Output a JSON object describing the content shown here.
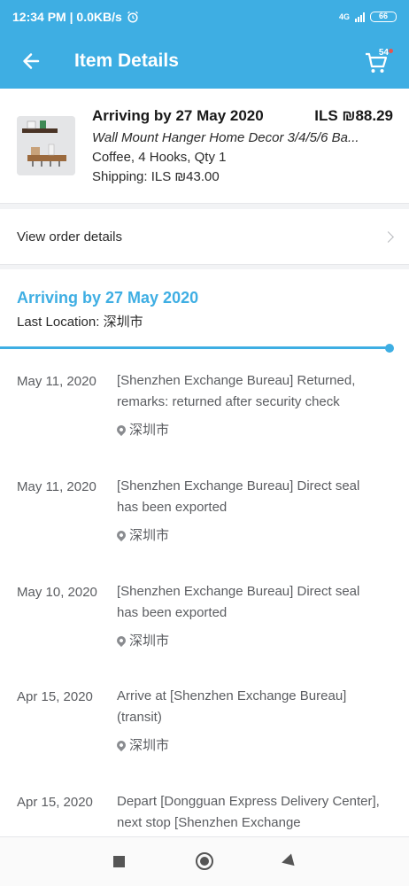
{
  "status_bar": {
    "time": "12:34 PM",
    "speed": "0.0KB/s",
    "network": "4G",
    "battery": "66"
  },
  "header": {
    "title": "Item Details",
    "cart_count": "54"
  },
  "item": {
    "arrival": "Arriving by 27 May 2020",
    "price": "ILS ₪88.29",
    "name": "Wall Mount Hanger Home Decor 3/4/5/6 Ba...",
    "variant": "Coffee, 4 Hooks, Qty 1",
    "shipping": "Shipping: ILS ₪43.00"
  },
  "order_link": {
    "label": "View order details"
  },
  "tracking": {
    "title": "Arriving by 27 May 2020",
    "last_location": "Last Location: 深圳市",
    "progress_fraction": 1.0,
    "events": [
      {
        "date": "May 11, 2020",
        "desc": "[Shenzhen Exchange Bureau] Returned, remarks: returned after security check",
        "location": "深圳市"
      },
      {
        "date": "May 11, 2020",
        "desc": "[Shenzhen Exchange Bureau] Direct seal has been exported",
        "location": "深圳市"
      },
      {
        "date": "May 10, 2020",
        "desc": "[Shenzhen Exchange Bureau] Direct seal has been exported",
        "location": "深圳市"
      },
      {
        "date": "Apr 15, 2020",
        "desc": "Arrive at [Shenzhen Exchange Bureau] (transit)",
        "location": "深圳市"
      },
      {
        "date": "Apr 15, 2020",
        "desc": "Depart [Dongguan Express Delivery Center], next stop [Shenzhen Exchange",
        "location": ""
      }
    ]
  },
  "colors": {
    "primary": "#3eaee3",
    "text_secondary": "#5b5d61",
    "background": "#f2f3f5"
  },
  "icons": {
    "back": "arrow-left-icon",
    "cart": "cart-icon",
    "chevron": "chevron-right-icon",
    "pin": "location-pin-icon"
  }
}
